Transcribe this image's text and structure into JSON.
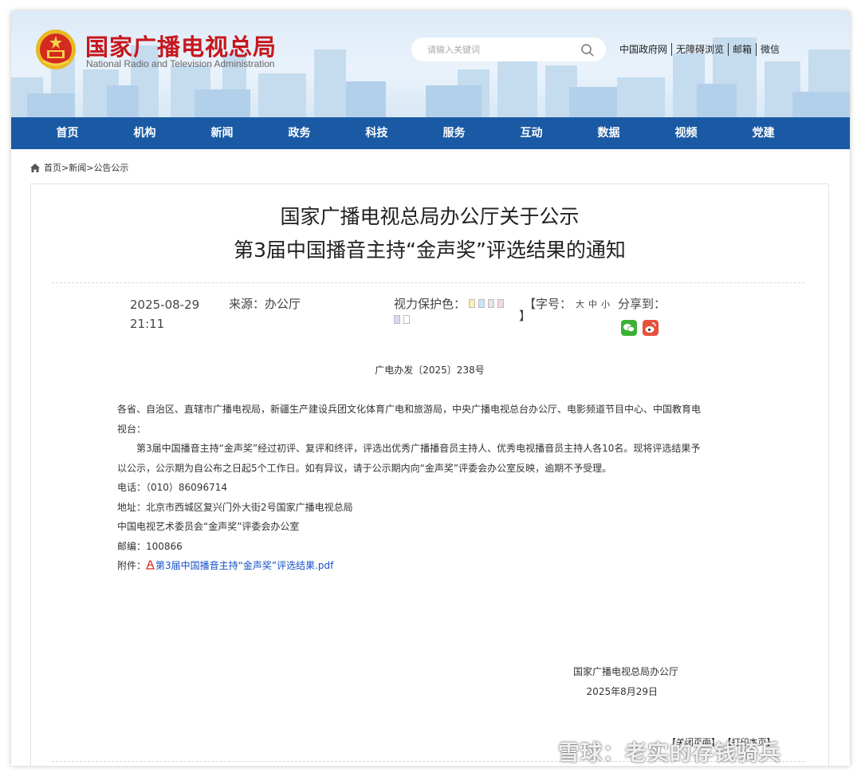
{
  "header": {
    "title_cn": "国家广播电视总局",
    "title_en": "National Radio and Television Administration",
    "search_placeholder": "请输入关键词",
    "links": [
      "中国政府网",
      "无障碍浏览",
      "邮箱",
      "微信"
    ]
  },
  "nav": [
    "首页",
    "机构",
    "新闻",
    "政务",
    "科技",
    "服务",
    "互动",
    "数据",
    "视频",
    "党建"
  ],
  "breadcrumb": [
    "首页>",
    "新闻>",
    "公告公示"
  ],
  "article": {
    "title_line1": "国家广播电视总局办公厅关于公示",
    "title_line2": "第3届中国播音主持“金声奖”评选结果的通知",
    "date": "2025-08-29 21:11",
    "source": "来源：办公厅",
    "eye_label": "视力保护色：",
    "eye_colors": [
      "#f8f3b0",
      "#c9e6f7",
      "#e6e6e6",
      "#f3d9e1",
      "#e2d6f2",
      "#ffffff"
    ],
    "font_label_open": "【字号：",
    "font_sizes": [
      "大",
      "中",
      "小"
    ],
    "font_label_close": "】",
    "share_label": "分享到：",
    "share_colors": {
      "wechat": "#3cb035",
      "weibo": "#e6513c"
    },
    "doc_number": "广电办发〔2025〕238号",
    "recipients": "各省、自治区、直辖市广播电视局，新疆生产建设兵团文化体育广电和旅游局，中央广播电视总台办公厅、电影频道节目中心、中国教育电视台：",
    "paragraph": "第3届中国播音主持“金声奖”经过初评、复评和终评，评选出优秀广播播音员主持人、优秀电视播音员主持人各10名。现将评选结果予以公示，公示期为自公布之日起5个工作日。如有异议，请于公示期内向“金声奖”评委会办公室反映，逾期不予受理。",
    "phone": "电话：（010）86096714",
    "address1": "地址：北京市西城区复兴门外大街2号国家广播电视总局",
    "address2": "中国电视艺术委员会“金声奖”评委会办公室",
    "postcode": "邮编：100866",
    "attachment_label": "附件：",
    "attachment_link": "第3届中国播音主持“金声奖”评选结果.pdf",
    "signer": "国家广播电视总局办公厅",
    "sign_date": "2025年8月29日",
    "close_link": "【关闭页面】",
    "print_link": "【打印本页】"
  },
  "watermark": "雪球：老实的存钱骑兵"
}
